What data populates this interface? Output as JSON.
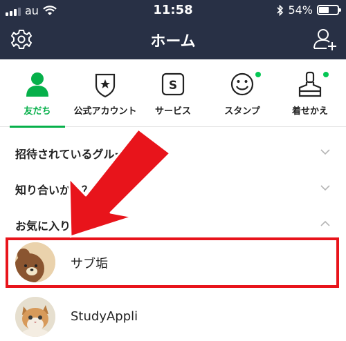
{
  "status_bar": {
    "carrier": "au",
    "time": "11:58",
    "battery": "54%",
    "battery_level": 0.54,
    "icons": [
      "signal-icon",
      "wifi-icon",
      "bluetooth-icon",
      "battery-icon"
    ]
  },
  "header": {
    "title": "ホーム",
    "left_icon": "gear-icon",
    "right_icon": "add-friend-icon"
  },
  "tabs": [
    {
      "label": "友だち",
      "icon": "person-icon",
      "active": true
    },
    {
      "label": "公式アカウント",
      "icon": "official-shield-icon",
      "active": false
    },
    {
      "label": "サービス",
      "icon": "service-icon",
      "active": false
    },
    {
      "label": "スタンプ",
      "icon": "smiley-icon",
      "active": false,
      "badge": true
    },
    {
      "label": "着せかえ",
      "icon": "brush-icon",
      "active": false,
      "badge": true
    }
  ],
  "sections": [
    {
      "label": "招待されているグルー",
      "expanded": false
    },
    {
      "label": "知り合いかも？",
      "expanded": false
    },
    {
      "label": "お気に入り 2",
      "expanded": true
    }
  ],
  "friends": [
    {
      "name": "サブ垢",
      "avatar": "bear-avatar",
      "highlighted": true
    },
    {
      "name": "StudyAppli",
      "avatar": "kitten-avatar",
      "highlighted": false
    }
  ],
  "colors": {
    "header_bg": "#283045",
    "accent_green": "#06b04a",
    "annotation_red": "#e8141b"
  }
}
